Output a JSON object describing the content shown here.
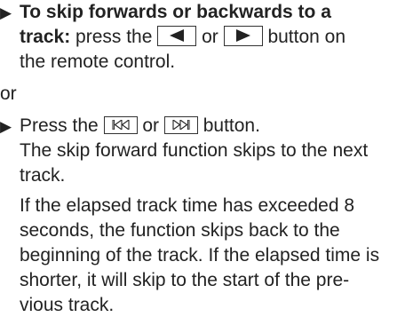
{
  "step1": {
    "bullet": "▶",
    "bold_line1": "To skip forwards or backwards to a",
    "bold_line2": "track:",
    "text_a": " press the ",
    "button_prev": "◀",
    "text_or": " or ",
    "button_next": "▶",
    "text_b": " button on",
    "line3": "the remote control."
  },
  "or_separator": "or",
  "step2": {
    "bullet": "▶",
    "text_a": "Press the ",
    "button_skip_back": "⏮",
    "text_or": " or ",
    "button_skip_fwd": "⏭",
    "text_b": " button.",
    "line2": "The skip forward function skips to the next",
    "line3": "track."
  },
  "paragraph": {
    "lines": [
      "If the elapsed track time has exceeded 8",
      "seconds, the function skips back to the",
      "beginning of the track. If the elapsed time is",
      "shorter, it will skip to the start of the pre-",
      "vious track."
    ]
  },
  "icons": {
    "prev_button_icon": "left-triangle-icon",
    "next_button_icon": "right-triangle-icon",
    "skip_back_icon": "skip-back-icon",
    "skip_forward_icon": "skip-forward-icon"
  }
}
